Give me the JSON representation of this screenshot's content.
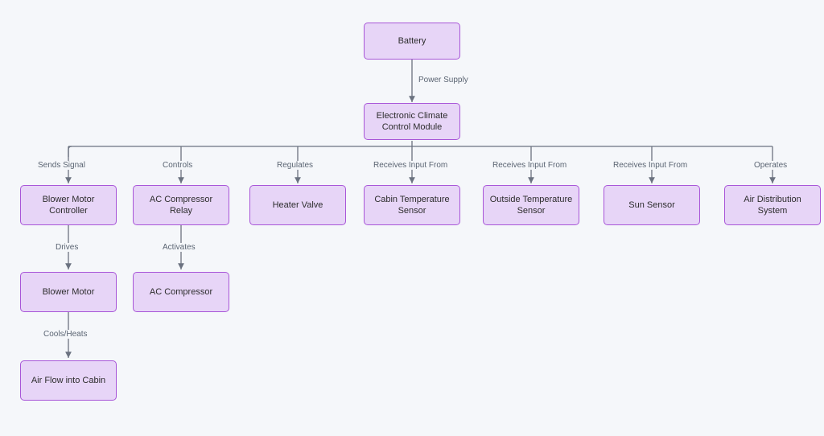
{
  "nodes": {
    "battery": "Battery",
    "eccm": "Electronic Climate Control Module",
    "bmc": "Blower Motor Controller",
    "acr": "AC Compressor Relay",
    "hv": "Heater Valve",
    "cts": "Cabin Temperature Sensor",
    "ots": "Outside Temperature Sensor",
    "ss": "Sun Sensor",
    "ads": "Air Distribution System",
    "bm": "Blower Motor",
    "acc": "AC Compressor",
    "af": "Air Flow into Cabin"
  },
  "edges": {
    "power": "Power Supply",
    "sends": "Sends Signal",
    "controls": "Controls",
    "regulates": "Regulates",
    "rif1": "Receives Input From",
    "rif2": "Receives Input From",
    "rif3": "Receives Input From",
    "operates": "Operates",
    "drives": "Drives",
    "activates": "Activates",
    "cools": "Cools/Heats"
  }
}
